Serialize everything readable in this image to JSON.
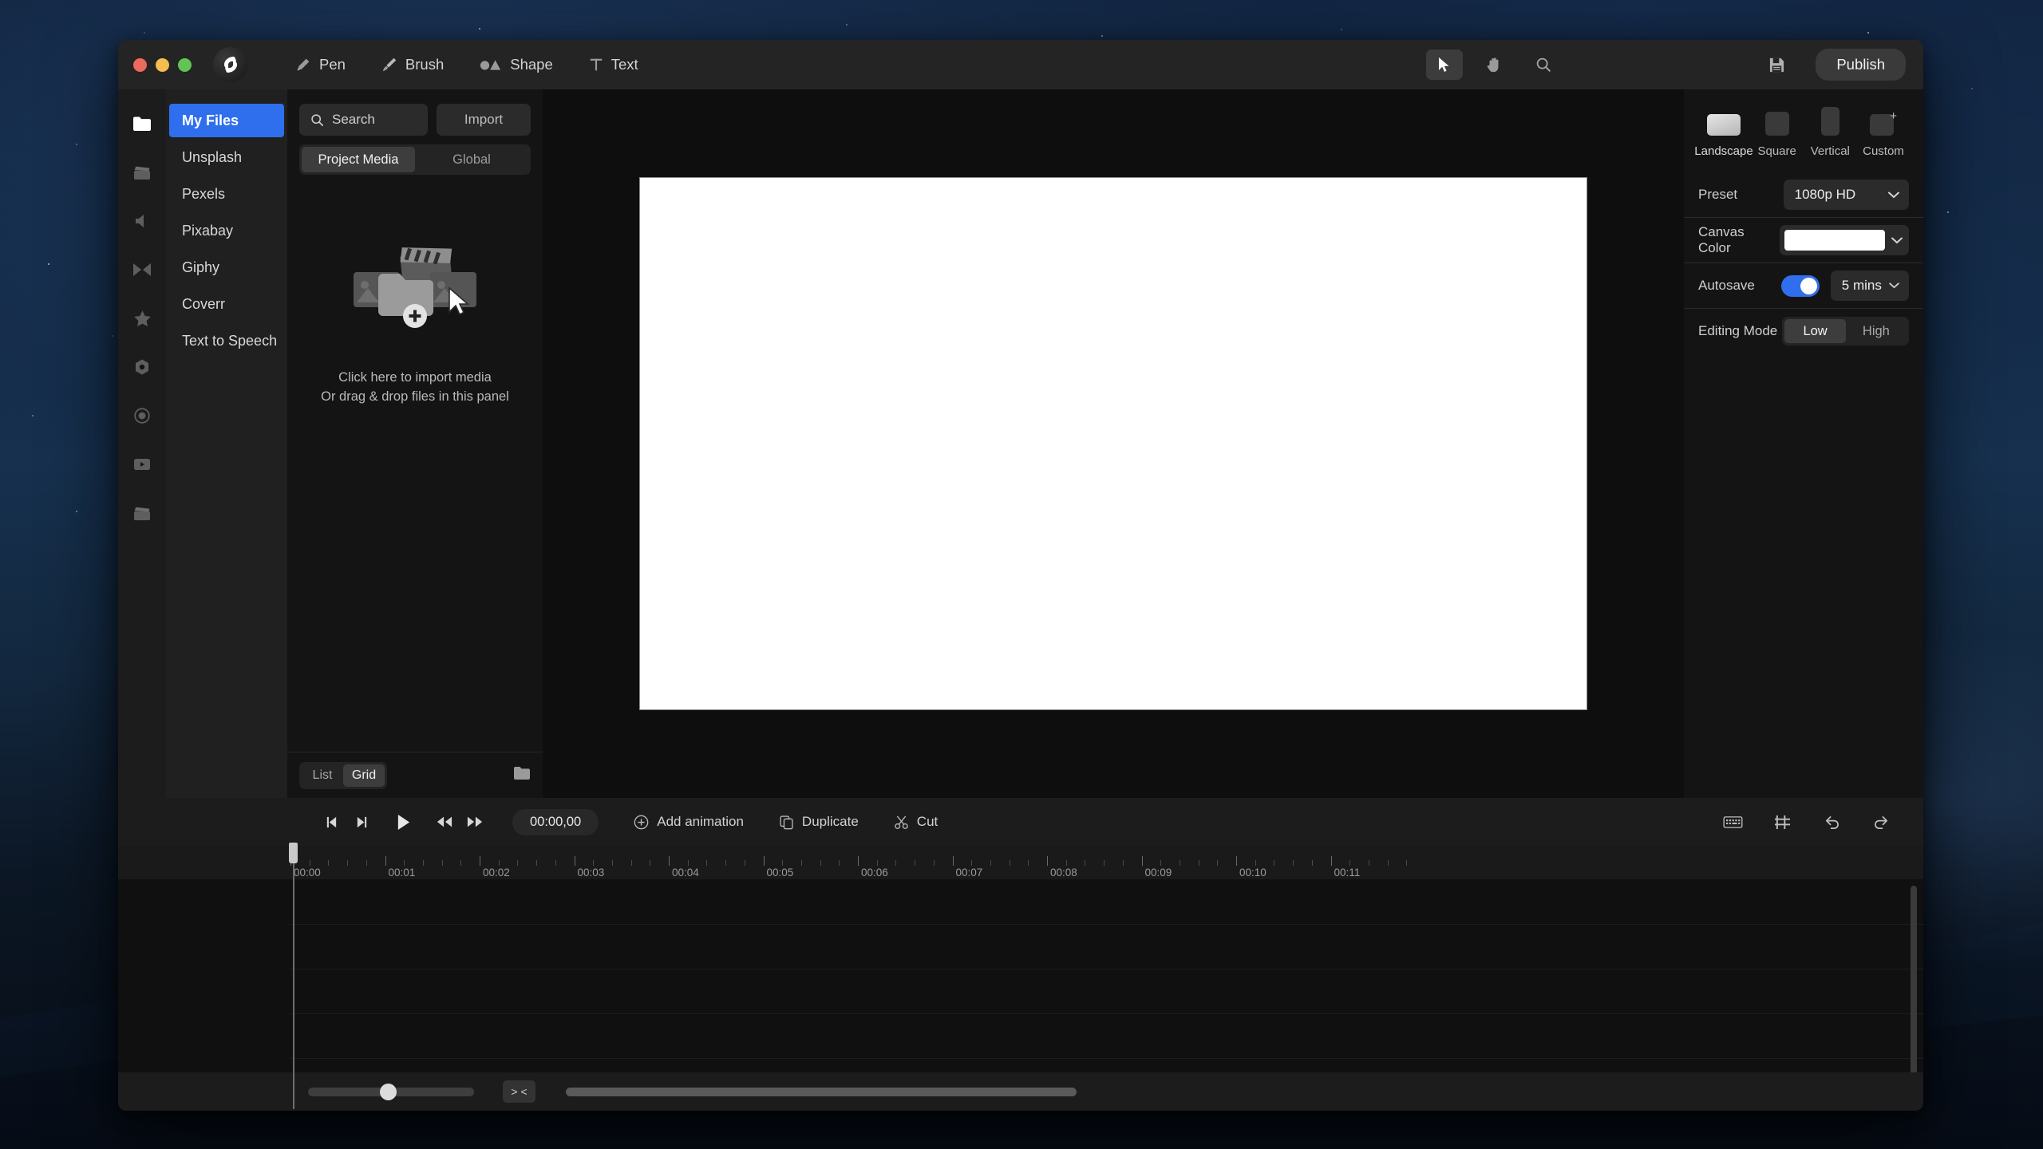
{
  "window": {
    "traffic_lights": [
      "close",
      "minimize",
      "maximize"
    ],
    "logo_name": "app-logo"
  },
  "toolbar": {
    "tools": [
      {
        "label": "Pen",
        "icon": "pen-icon"
      },
      {
        "label": "Brush",
        "icon": "brush-icon"
      },
      {
        "label": "Shape",
        "icon": "shape-icon"
      },
      {
        "label": "Text",
        "icon": "text-icon"
      }
    ],
    "right_tools": [
      {
        "name": "select-tool",
        "icon": "cursor-icon",
        "active": true
      },
      {
        "name": "hand-tool",
        "icon": "hand-icon",
        "active": false
      },
      {
        "name": "zoom-tool",
        "icon": "search-icon",
        "active": false
      }
    ],
    "save_icon": "save-icon",
    "publish_label": "Publish"
  },
  "rail": {
    "items": [
      {
        "name": "media",
        "icon": "folder-icon",
        "active": true
      },
      {
        "name": "video",
        "icon": "clapperboard-icon",
        "active": false
      },
      {
        "name": "audio",
        "icon": "speaker-icon",
        "active": false
      },
      {
        "name": "transitions",
        "icon": "transition-icon",
        "active": false
      },
      {
        "name": "effects",
        "icon": "star-icon",
        "active": false
      },
      {
        "name": "elements",
        "icon": "sticker-icon",
        "active": false
      },
      {
        "name": "record",
        "icon": "record-icon",
        "active": false
      },
      {
        "name": "export",
        "icon": "play-box-icon",
        "active": false
      },
      {
        "name": "templates",
        "icon": "clapperboard-icon",
        "active": false
      }
    ]
  },
  "sources": {
    "items": [
      {
        "label": "My Files",
        "active": true
      },
      {
        "label": "Unsplash",
        "active": false
      },
      {
        "label": "Pexels",
        "active": false
      },
      {
        "label": "Pixabay",
        "active": false
      },
      {
        "label": "Giphy",
        "active": false
      },
      {
        "label": "Coverr",
        "active": false
      },
      {
        "label": "Text to Speech",
        "active": false
      }
    ]
  },
  "media_panel": {
    "search_placeholder": "Search",
    "search_value": "",
    "import_label": "Import",
    "tabs": [
      {
        "label": "Project Media",
        "active": true
      },
      {
        "label": "Global",
        "active": false
      }
    ],
    "dropzone_line1": "Click here to import media",
    "dropzone_line2": "Or drag & drop files in this panel",
    "view_modes": [
      {
        "label": "List",
        "active": false
      },
      {
        "label": "Grid",
        "active": true
      }
    ]
  },
  "preview": {
    "canvas_color": "#ffffff",
    "cursor": "arrow-cursor"
  },
  "properties": {
    "ratios": [
      {
        "label": "Landscape",
        "active": true
      },
      {
        "label": "Square",
        "active": false
      },
      {
        "label": "Vertical",
        "active": false
      },
      {
        "label": "Custom",
        "active": false
      }
    ],
    "preset_label": "Preset",
    "preset_value": "1080p HD",
    "canvas_color_label": "Canvas Color",
    "canvas_color_value": "#ffffff",
    "autosave_label": "Autosave",
    "autosave_enabled": true,
    "autosave_interval": "5 mins",
    "editing_mode_label": "Editing Mode",
    "editing_modes": [
      {
        "label": "Low",
        "active": true
      },
      {
        "label": "High",
        "active": false
      }
    ],
    "accent_color": "#2f6fed"
  },
  "timeline": {
    "controls": [
      {
        "name": "skip-to-start",
        "icon": "skip-start-icon"
      },
      {
        "name": "skip-to-end",
        "icon": "skip-end-icon"
      },
      {
        "name": "play",
        "icon": "play-icon"
      },
      {
        "name": "rewind",
        "icon": "rewind-icon"
      },
      {
        "name": "fast-forward",
        "icon": "fast-forward-icon"
      }
    ],
    "timecode": "00:00,00",
    "actions": [
      {
        "label": "Add animation",
        "icon": "plus-circle-icon"
      },
      {
        "label": "Duplicate",
        "icon": "duplicate-icon"
      },
      {
        "label": "Cut",
        "icon": "scissors-icon"
      }
    ],
    "right_icons": [
      {
        "name": "keyboard-shortcuts",
        "icon": "keyboard-icon"
      },
      {
        "name": "markers",
        "icon": "marker-icon"
      },
      {
        "name": "undo",
        "icon": "undo-icon"
      },
      {
        "name": "redo",
        "icon": "redo-icon"
      }
    ],
    "ruler_labels": [
      "00:00",
      "00:01",
      "00:02",
      "00:03",
      "00:04",
      "00:05",
      "00:06",
      "00:07",
      "00:08",
      "00:09",
      "00:10",
      "00:11"
    ],
    "playhead_position": "00:00",
    "zoom_level": 48,
    "fit_label": "> <"
  }
}
